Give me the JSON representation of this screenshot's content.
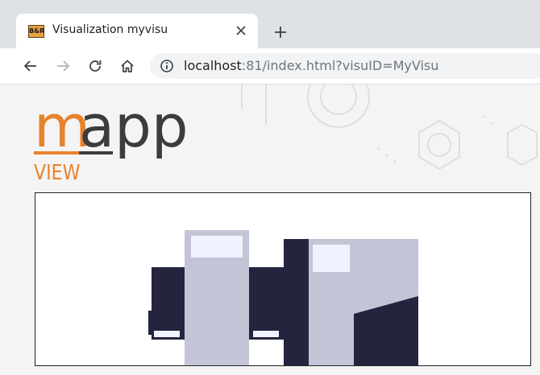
{
  "browser": {
    "tab": {
      "favicon_text": "B&R",
      "title": "Visualization myvisu",
      "close_icon": "close-icon"
    },
    "new_tab_icon": "plus-icon",
    "nav": {
      "back_icon": "arrow-left-icon",
      "forward_icon": "arrow-right-icon",
      "reload_icon": "reload-icon",
      "home_icon": "home-icon"
    },
    "address": {
      "host": "localhost",
      "rest": ":81/index.html?visuID=MyVisu"
    }
  },
  "logo": {
    "mapp_m": "m",
    "mapp_rest": "app",
    "view": "VIEW"
  },
  "colors": {
    "brand_orange": "#e8832b",
    "logo_gray": "#3c3c3c",
    "machine_dark": "#24243f",
    "machine_light": "#c3c5d6",
    "window_panel": "#eef3ff"
  }
}
